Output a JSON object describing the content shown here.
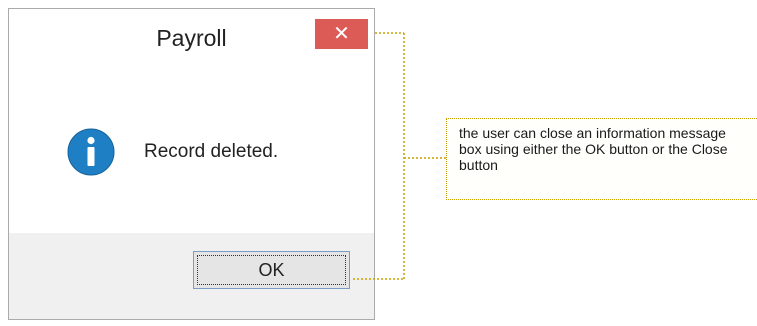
{
  "dialog": {
    "title": "Payroll",
    "close_label": "✕",
    "message": "Record deleted.",
    "icon": "info-icon",
    "ok_label": "OK"
  },
  "callout": {
    "text": "the user can close an information message box using either the OK button or the Close button"
  },
  "colors": {
    "close_button": "#dd5b57",
    "info_icon": "#1f7fc4",
    "callout_line": "#c8a000"
  }
}
